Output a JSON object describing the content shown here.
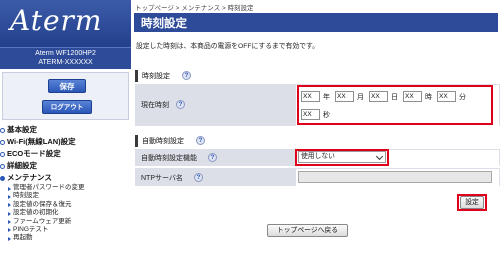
{
  "brand": {
    "logo_text": "Aterm",
    "model_line1": "Aterm  WF1200HP2",
    "model_line2": "ATERM-XXXXXX"
  },
  "sidebar": {
    "save_label": "保存",
    "logout_label": "ログアウト",
    "nav": [
      {
        "label": "基本設定"
      },
      {
        "label": "Wi-Fi(無線LAN)設定"
      },
      {
        "label": "ECOモード設定"
      },
      {
        "label": "詳細設定"
      },
      {
        "label": "メンテナンス"
      }
    ],
    "maintenance_items": [
      {
        "label": "管理者パスワードの変更"
      },
      {
        "label": "時刻設定"
      },
      {
        "label": "設定値の保存＆復元"
      },
      {
        "label": "設定値の初期化"
      },
      {
        "label": "ファームウェア更新"
      },
      {
        "label": "PINGテスト"
      },
      {
        "label": "再起動"
      }
    ]
  },
  "breadcrumb": "トップページ > メンテナンス > 時刻設定",
  "page_title": "時刻設定",
  "notice": "設定した時刻は、本商品の電源をOFFにするまで有効です。",
  "time_section": {
    "heading": "時刻設定",
    "current_time_label": "現在時刻",
    "fields": {
      "year": "XX",
      "month": "XX",
      "day": "XX",
      "hour": "XX",
      "minute": "XX",
      "second": "XX"
    },
    "units": {
      "year": "年",
      "month": "月",
      "day": "日",
      "hour": "時",
      "minute": "分",
      "second": "秒"
    }
  },
  "auto_section": {
    "heading": "自動時刻設定",
    "auto_function_label": "自動時刻設定機能",
    "auto_function_value": "使用しない",
    "ntp_label": "NTPサーバ名",
    "ntp_value": ""
  },
  "buttons": {
    "apply_label": "設定",
    "back_label": "トップページへ戻る"
  },
  "help_glyph": "?",
  "colors": {
    "brand_blue": "#2d4b98",
    "highlight_red": "#e0001b",
    "row_gray": "#dcdfe8"
  }
}
